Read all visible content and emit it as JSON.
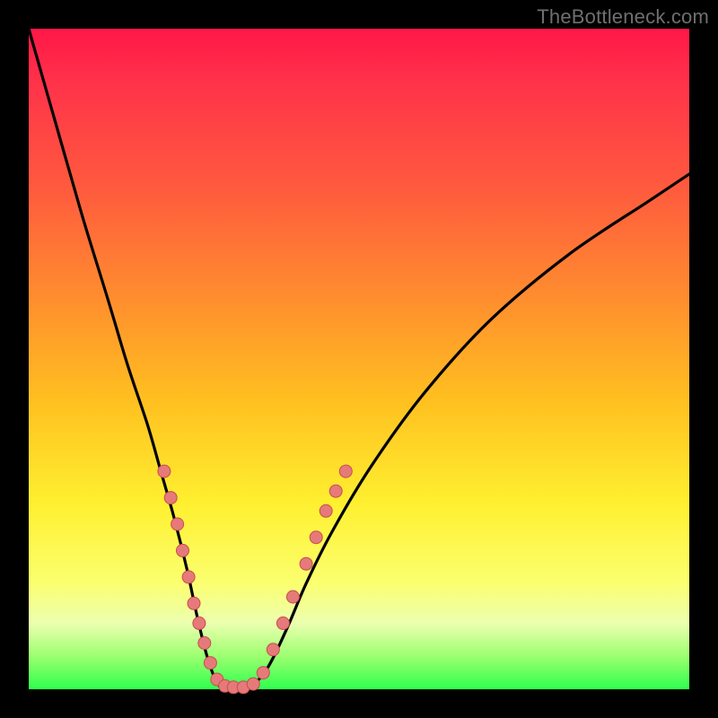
{
  "watermark": "TheBottleneck.com",
  "colors": {
    "frame": "#000000",
    "curve": "#000000",
    "dot_fill": "#e67a7a",
    "dot_stroke": "#c74d4d"
  },
  "chart_data": {
    "type": "line",
    "title": "",
    "xlabel": "",
    "ylabel": "",
    "xlim": [
      0,
      100
    ],
    "ylim": [
      0,
      100
    ],
    "series": [
      {
        "name": "bottleneck-curve",
        "x": [
          0,
          4,
          8,
          12,
          15,
          18,
          20,
          22,
          24,
          25.5,
          27,
          28.5,
          30,
          33,
          36,
          39,
          42,
          46,
          52,
          60,
          70,
          82,
          94,
          100
        ],
        "y": [
          100,
          86,
          72,
          59,
          49,
          40,
          33,
          26,
          18,
          11,
          5,
          1,
          0,
          0,
          3,
          9,
          16,
          24,
          34,
          45,
          56,
          66,
          74,
          78
        ]
      }
    ],
    "dots": {
      "name": "highlight-dots",
      "points": [
        {
          "x": 20.5,
          "y": 33
        },
        {
          "x": 21.5,
          "y": 29
        },
        {
          "x": 22.5,
          "y": 25
        },
        {
          "x": 23.3,
          "y": 21
        },
        {
          "x": 24.2,
          "y": 17
        },
        {
          "x": 25.0,
          "y": 13
        },
        {
          "x": 25.8,
          "y": 10
        },
        {
          "x": 26.6,
          "y": 7
        },
        {
          "x": 27.5,
          "y": 4
        },
        {
          "x": 28.5,
          "y": 1.5
        },
        {
          "x": 29.7,
          "y": 0.5
        },
        {
          "x": 31.0,
          "y": 0.3
        },
        {
          "x": 32.5,
          "y": 0.3
        },
        {
          "x": 34.0,
          "y": 0.8
        },
        {
          "x": 35.5,
          "y": 2.5
        },
        {
          "x": 37.0,
          "y": 6
        },
        {
          "x": 38.5,
          "y": 10
        },
        {
          "x": 40.0,
          "y": 14
        },
        {
          "x": 42.0,
          "y": 19
        },
        {
          "x": 43.5,
          "y": 23
        },
        {
          "x": 45.0,
          "y": 27
        },
        {
          "x": 46.5,
          "y": 30
        },
        {
          "x": 48.0,
          "y": 33
        }
      ]
    }
  }
}
